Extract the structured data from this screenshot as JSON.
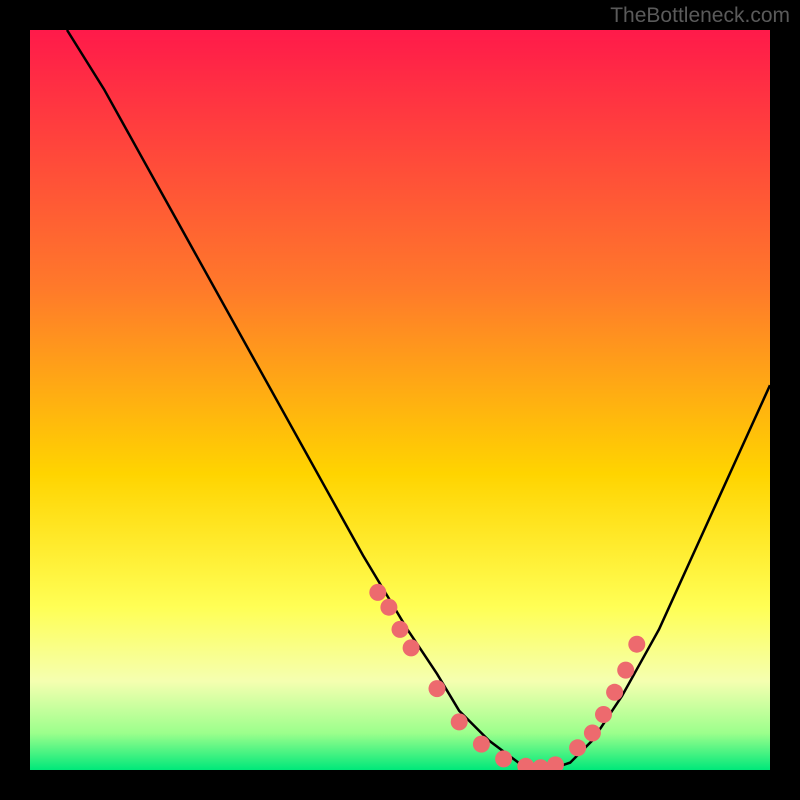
{
  "watermark": "TheBottleneck.com",
  "chart_data": {
    "type": "line",
    "title": "",
    "xlabel": "",
    "ylabel": "",
    "xlim": [
      0,
      100
    ],
    "ylim": [
      0,
      100
    ],
    "gradient_stops": [
      {
        "offset": 0,
        "color": "#ff1a4a"
      },
      {
        "offset": 35,
        "color": "#ff7a2a"
      },
      {
        "offset": 60,
        "color": "#ffd400"
      },
      {
        "offset": 78,
        "color": "#ffff55"
      },
      {
        "offset": 88,
        "color": "#f5ffb0"
      },
      {
        "offset": 95,
        "color": "#9cff8c"
      },
      {
        "offset": 100,
        "color": "#00e87a"
      }
    ],
    "series": [
      {
        "name": "bottleneck-curve",
        "type": "line",
        "x": [
          5,
          10,
          15,
          20,
          25,
          30,
          35,
          40,
          45,
          48,
          51,
          55,
          58,
          62,
          66,
          70,
          73,
          76,
          80,
          85,
          90,
          95,
          100
        ],
        "y": [
          100,
          92,
          83,
          74,
          65,
          56,
          47,
          38,
          29,
          24,
          19,
          13,
          8,
          4,
          1,
          0,
          1,
          4,
          10,
          19,
          30,
          41,
          52
        ]
      },
      {
        "name": "marker-cluster",
        "type": "scatter",
        "x": [
          47,
          48.5,
          50,
          51.5,
          55,
          58,
          61,
          64,
          67,
          69,
          71,
          74,
          76,
          77.5,
          79,
          80.5,
          82
        ],
        "y": [
          24,
          22,
          19,
          16.5,
          11,
          6.5,
          3.5,
          1.5,
          0.5,
          0.3,
          0.7,
          3,
          5,
          7.5,
          10.5,
          13.5,
          17
        ]
      }
    ],
    "marker_color": "#ed6a6e",
    "line_color": "#000000"
  }
}
